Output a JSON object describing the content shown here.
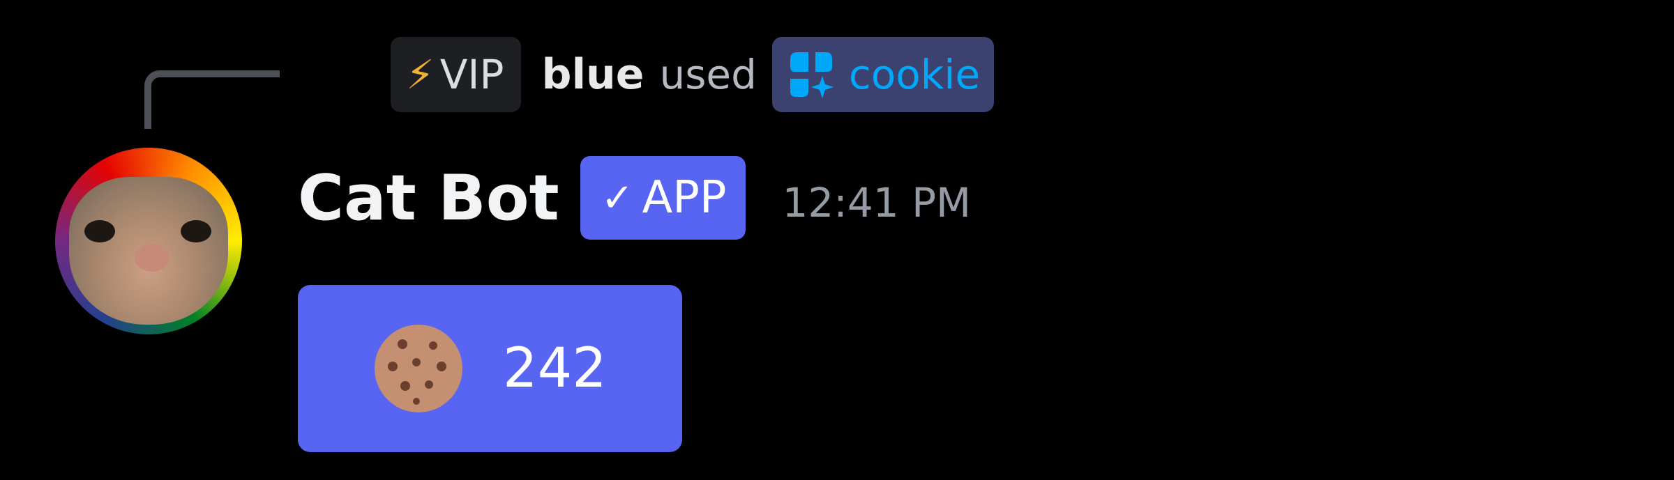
{
  "reply": {
    "tag_icon": "lightning-bolt-icon",
    "tag_bolt": "⚡",
    "tag_label": "VIP",
    "username": "blue",
    "action": "used",
    "command_icon": "app-command-icon",
    "command_name": "cookie"
  },
  "message": {
    "author": "Cat Bot",
    "author_avatar": "cat-face-avatar-with-rainbow-border",
    "badge_check": "✓",
    "badge_label": "APP",
    "timestamp": "12:41 PM"
  },
  "button": {
    "icon": "cookie-icon",
    "count": "242"
  },
  "colors": {
    "background": "#000000",
    "blurple": "#5865f2",
    "command_chip_bg": "#3c4270",
    "command_text": "#00a8fc",
    "vip_tag_bg": "#1e1f22",
    "bolt": "#f0b232",
    "timestamp": "#949ba4",
    "cookie": "#c58f72",
    "cookie_chips": "#6b3e2e"
  }
}
